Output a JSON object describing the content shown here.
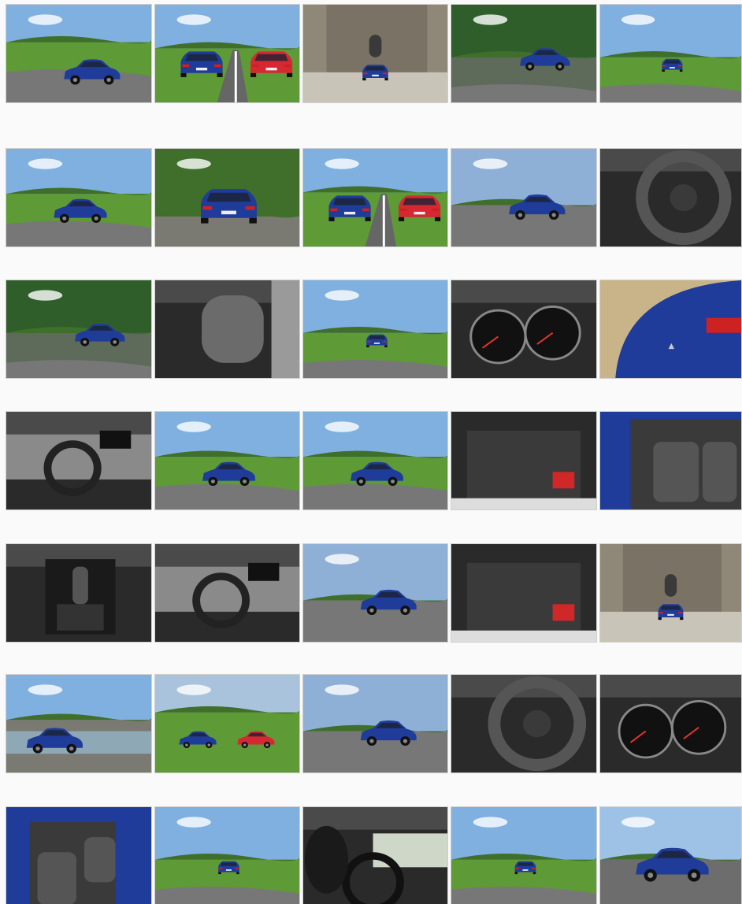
{
  "gallery": {
    "rows": [
      [
        "vineyard-car",
        "two-cars-road",
        "castle-car",
        "forest-road-car",
        "vineyard-road-car"
      ],
      [
        "vineyard-hill-car",
        "rear-car-trees",
        "two-cars-road",
        "quarry-car",
        "steering-wheel-closeup"
      ],
      [
        "forest-road-car",
        "headrest-closeup",
        "vineyard-road-car",
        "dashboard-gauges",
        "rear-badge-closeup"
      ],
      [
        "interior-dashboard",
        "vineyard-hill-car",
        "vineyard-hill-car",
        "trunk-open",
        "rear-seats"
      ],
      [
        "gear-shifter",
        "interior-dashboard",
        "quarry-car",
        "trunk-open",
        "castle-car"
      ],
      [
        "lake-car",
        "two-cars-field",
        "quarry-car",
        "steering-wheel-closeup",
        "dashboard-gauges"
      ],
      [
        "front-seats",
        "vineyard-road-car",
        "driver-cockpit",
        "vineyard-road-car",
        "front-car-trees"
      ]
    ]
  },
  "colors": {
    "car_blue": "#1f3c9a",
    "car_red": "#d62832",
    "sky": "#7fb0df",
    "grass": "#5e9a36",
    "asphalt": "#777777",
    "interior": "#2a2a2a"
  }
}
